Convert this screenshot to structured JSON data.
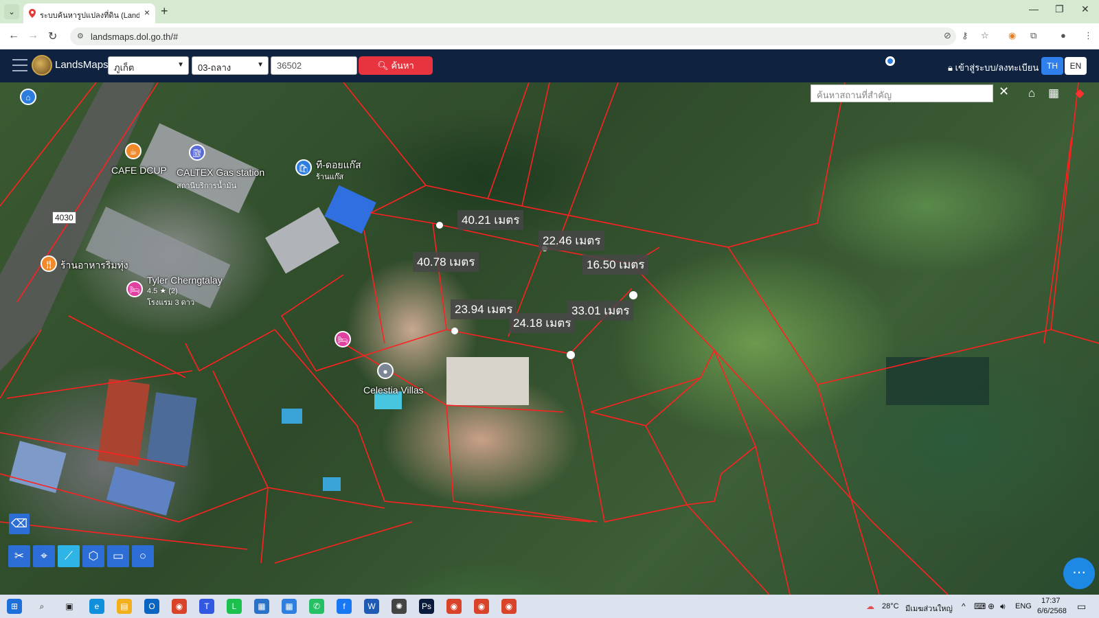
{
  "browser": {
    "tab_title": "ระบบค้นหารูปแปลงที่ดิน (LandsMap",
    "url": "landsmaps.dol.go.th/#"
  },
  "app": {
    "brand": "LandsMaps",
    "province": "ภูเก็ต",
    "district": "03-ถลาง",
    "parcel_number": "36502",
    "search_label": "ค้นหา",
    "login_label": "เข้าสู่ระบบ/ลงทะเบียน",
    "lang_th": "TH",
    "lang_en": "EN"
  },
  "map": {
    "search_placeholder": "ค้นหาสถานที่สำคัญ",
    "road_number": "4030",
    "places": {
      "cafe": "CAFE DCUP",
      "caltex": "CALTEX Gas station",
      "caltex_sub": "สถานีบริการน้ำมัน",
      "gas_shop": "ที-ดอยแก๊ส",
      "gas_shop_sub": "ร้านแก๊ส",
      "restaurant": "ร้านอาหารริมทุ่ง",
      "hotel": "Tyler Cherngtalay",
      "hotel_rating": "4.5 ★ (2)",
      "hotel_sub": "โรงแรม 3 ดาว",
      "villas": "Celestia Villas"
    },
    "measurements": {
      "m1": "40.21 เมตร",
      "m2": "22.46 เมตร",
      "m3": "16.50 เมตร",
      "m4": "40.78 เมตร",
      "m5": "23.94 เมตร",
      "m6": "24.18 เมตร",
      "m7": "33.01 เมตร"
    }
  },
  "taskbar": {
    "weather": "28°C",
    "weather_desc": "มีเมฆส่วนใหญ่",
    "input_lang": "ENG",
    "time": "17:37",
    "date": "6/6/2568"
  }
}
